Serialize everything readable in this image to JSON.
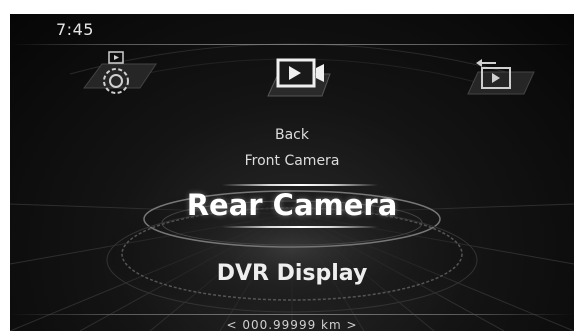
{
  "status": {
    "time": "7:45"
  },
  "top_icons": [
    {
      "name": "camera-settings-icon"
    },
    {
      "name": "camera-play-icon"
    },
    {
      "name": "return-play-icon"
    }
  ],
  "menu": {
    "items": [
      {
        "label": "Back"
      },
      {
        "label": "Front Camera"
      },
      {
        "label": "Rear Camera",
        "selected": true
      },
      {
        "label": "DVR Display"
      }
    ]
  },
  "footer": {
    "odometer": "< 000.99999 km >"
  },
  "colors": {
    "background": "#0a0a0a",
    "text": "#ffffff",
    "accent": "#d8d8d8"
  }
}
